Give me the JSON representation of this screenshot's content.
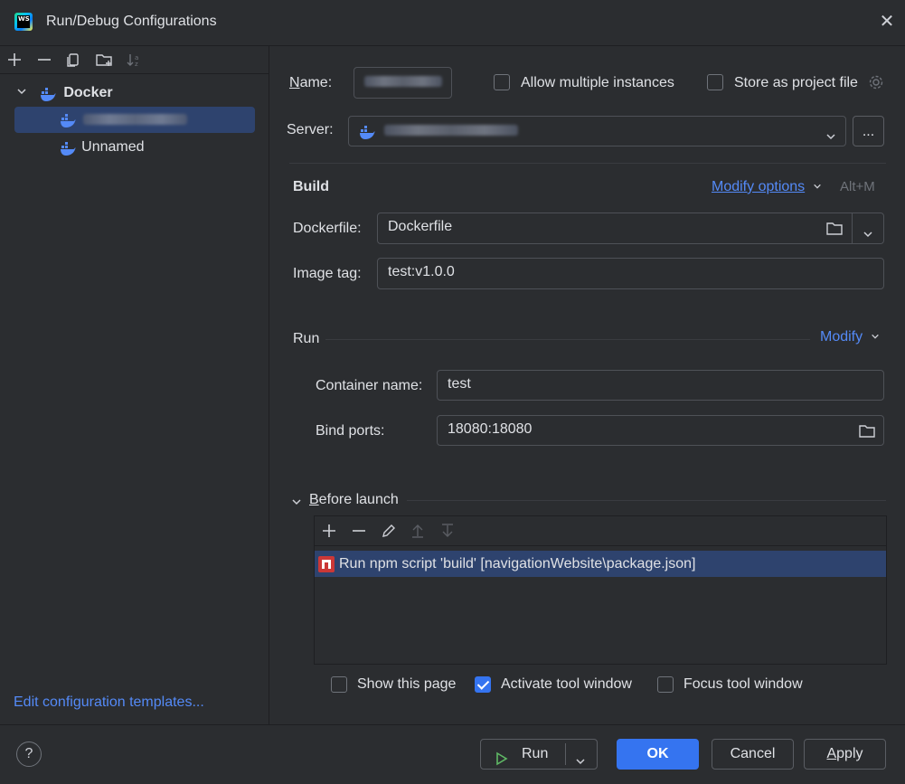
{
  "window": {
    "title": "Run/Debug Configurations"
  },
  "toolbar": {
    "icons": [
      "add-icon",
      "remove-icon",
      "copy-icon",
      "new-folder-icon",
      "sort-icon"
    ]
  },
  "tree": {
    "group_label": "Docker",
    "items": [
      {
        "label": "",
        "selected": true,
        "redacted": true
      },
      {
        "label": "Unnamed",
        "selected": false
      }
    ]
  },
  "left_footer": {
    "edit_templates": "Edit configuration templates..."
  },
  "form": {
    "name_label": "Name:",
    "name_value": "",
    "allow_multiple_label": "Allow multiple instances",
    "allow_multiple_checked": false,
    "store_project_label": "Store as project file",
    "store_project_checked": false,
    "server_label": "Server:",
    "server_value": "",
    "server_browse_label": "...",
    "build_header": "Build",
    "modify_options_label": "Modify options",
    "modify_options_shortcut": "Alt+M",
    "dockerfile_label": "Dockerfile:",
    "dockerfile_value": "Dockerfile",
    "image_tag_label": "Image tag:",
    "image_tag_value": "test:v1.0.0",
    "run_header": "Run",
    "run_modify_label": "Modify",
    "container_name_label": "Container name:",
    "container_name_value": "test",
    "bind_ports_label": "Bind ports:",
    "bind_ports_value": "18080:18080"
  },
  "before_launch": {
    "header": "Before launch",
    "tasks": [
      {
        "label": "Run npm script 'build' [navigationWebsite\\package.json]",
        "icon": "npm-icon"
      }
    ],
    "show_page_label": "Show this page",
    "show_page_checked": false,
    "activate_tool_label": "Activate tool window",
    "activate_tool_checked": true,
    "focus_tool_label": "Focus tool window",
    "focus_tool_checked": false
  },
  "buttons": {
    "help": "?",
    "run": "Run",
    "ok": "OK",
    "cancel": "Cancel",
    "apply": "Apply"
  },
  "colors": {
    "background": "#2b2d30",
    "accent": "#3574f0",
    "link": "#548af7",
    "selection": "#2e436e"
  }
}
